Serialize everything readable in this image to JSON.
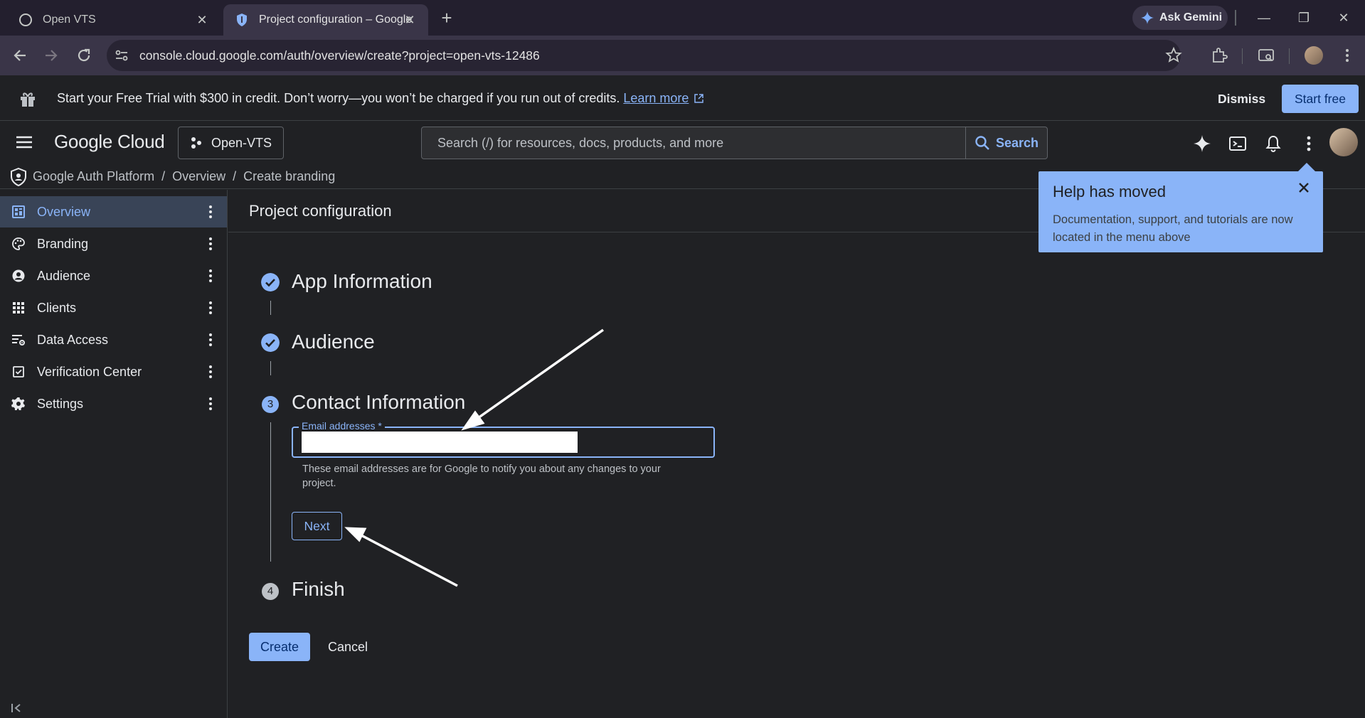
{
  "browser": {
    "tabs": [
      {
        "title": "Open VTS"
      },
      {
        "title": "Project configuration – Google"
      }
    ],
    "ask_gemini": "Ask Gemini",
    "url": "console.cloud.google.com/auth/overview/create?project=open-vts-12486"
  },
  "banner": {
    "text": "Start your Free Trial with $300 in credit. Don’t worry—you won’t be charged if you run out of credits. ",
    "link": "Learn more",
    "dismiss": "Dismiss",
    "start_free": "Start free"
  },
  "header": {
    "brand": "Google Cloud",
    "project": "Open-VTS",
    "search_placeholder": "Search (/) for resources, docs, products, and more",
    "search_button": "Search"
  },
  "breadcrumb": [
    "Google Auth Platform",
    "Overview",
    "Create branding"
  ],
  "sidebar": {
    "items": [
      {
        "label": "Overview",
        "icon": "dashboard-icon",
        "active": true
      },
      {
        "label": "Branding",
        "icon": "palette-icon"
      },
      {
        "label": "Audience",
        "icon": "person-icon"
      },
      {
        "label": "Clients",
        "icon": "grid-icon"
      },
      {
        "label": "Data Access",
        "icon": "data-settings-icon"
      },
      {
        "label": "Verification Center",
        "icon": "verified-icon"
      },
      {
        "label": "Settings",
        "icon": "gear-icon"
      }
    ]
  },
  "main": {
    "title": "Project configuration",
    "steps": [
      {
        "label": "App Information",
        "state": "done"
      },
      {
        "label": "Audience",
        "state": "done"
      },
      {
        "label": "Contact Information",
        "state": "current",
        "number": "3"
      },
      {
        "label": "Finish",
        "state": "pending",
        "number": "4"
      }
    ],
    "email_label": "Email addresses *",
    "email_value": "",
    "email_help": "These email addresses are for Google to notify you about any changes to your project.",
    "next": "Next",
    "create": "Create",
    "cancel": "Cancel"
  },
  "help_popover": {
    "title": "Help has moved",
    "body": "Documentation, support, and tutorials are now located in the menu above"
  },
  "colors": {
    "accent": "#8ab4f8",
    "background": "#202124",
    "active_nav": "#394457"
  }
}
